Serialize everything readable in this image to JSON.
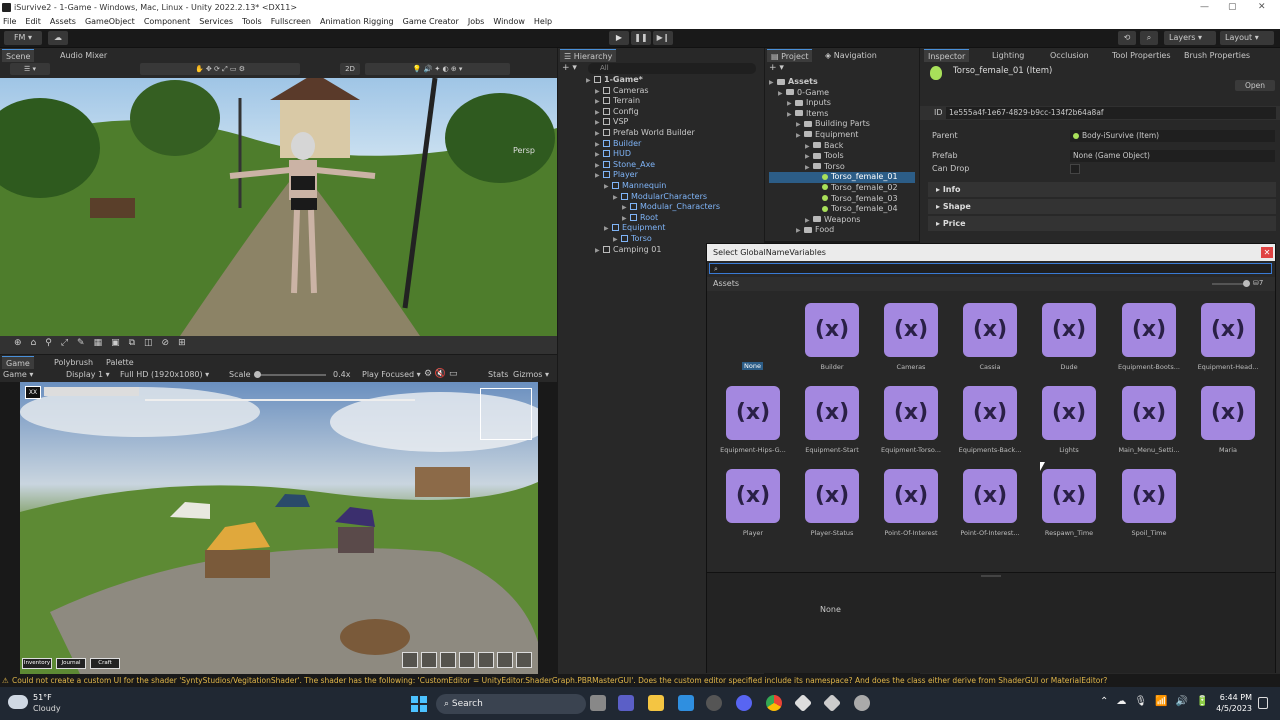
{
  "window": {
    "title": "iSurvive2 - 1-Game - Windows, Mac, Linux - Unity 2022.2.13* <DX11>"
  },
  "menu": [
    "File",
    "Edit",
    "Assets",
    "GameObject",
    "Component",
    "Services",
    "Tools",
    "Fullscreen",
    "Animation Rigging",
    "Game Creator",
    "Jobs",
    "Window",
    "Help"
  ],
  "toolbar": {
    "account": "FM",
    "layers": "Layers",
    "layout": "Layout"
  },
  "scene": {
    "tab_scene": "Scene",
    "tab_audio": "Audio Mixer",
    "mode_2d": "2D",
    "persp": "Persp"
  },
  "game": {
    "tab_game": "Game",
    "tab_polybrush": "Polybrush",
    "tab_palette": "Palette",
    "view": "Game",
    "display": "Display 1",
    "resolution": "Full HD (1920x1080)",
    "scale_label": "Scale",
    "scale_value": "0.4x",
    "play_focused": "Play Focused",
    "stats": "Stats",
    "gizmos": "Gizmos",
    "hud_id": "XX",
    "btn_inventory": "Inventory",
    "btn_journal": "Journal",
    "btn_craft": "Craft"
  },
  "hierarchy": {
    "tab": "Hierarchy",
    "search_placeholder": "All",
    "items": [
      "1-Game*",
      "Cameras",
      "Terrain",
      "Config",
      "VSP",
      "Prefab World Builder",
      "Builder",
      "HUD",
      "Stone_Axe",
      "Player",
      "Mannequin",
      "ModularCharacters",
      "Modular_Characters",
      "Root",
      "Equipment",
      "Torso",
      "Camping 01"
    ]
  },
  "project": {
    "tab_project": "Project",
    "tab_navigation": "Navigation",
    "items": [
      "Assets",
      "0-Game",
      "Inputs",
      "Items",
      "Building Parts",
      "Equipment",
      "Back",
      "Tools",
      "Torso",
      "Torso_female_01",
      "Torso_female_02",
      "Torso_female_03",
      "Torso_female_04",
      "Weapons",
      "Food"
    ]
  },
  "inspector": {
    "tabs": [
      "Inspector",
      "Lighting",
      "Occlusion",
      "Tool Properties",
      "Brush Properties"
    ],
    "object_title": "Torso_female_01 (Item)",
    "open": "Open",
    "id_label": "ID",
    "id_value": "1e555a4f-1e67-4829-b9cc-134f2b64a8af",
    "parent_label": "Parent",
    "parent_value": "Body-iSurvive (Item)",
    "prefab_label": "Prefab",
    "prefab_value": "None (Game Object)",
    "candrop_label": "Can Drop",
    "sections": [
      "Info",
      "Shape",
      "Price"
    ]
  },
  "dialog": {
    "title": "Select GlobalNameVariables",
    "assets_label": "Assets",
    "count": "7",
    "none_label": "None",
    "footer_none": "None",
    "glyph": "(x)",
    "items": [
      "Builder",
      "Cameras",
      "Cassia",
      "Dude",
      "Equipment-Boots...",
      "Equipment-Head...",
      "Equipment-Hips-G...",
      "Equipment-Start",
      "Equipment-Torso...",
      "Equipments-Back...",
      "Lights",
      "Main_Menu_Setti...",
      "Maria",
      "Player",
      "Player-Status",
      "Point-Of-Interest",
      "Point-Of-Interest...",
      "Respawn_Time",
      "Spoil_Time"
    ]
  },
  "status": {
    "message": "Could not create a custom UI for the shader 'SyntyStudios/VegitationShader'. The shader has the following: 'CustomEditor = UnityEditor.ShaderGraph.PBRMasterGUI'. Does the custom editor specified include its namespace? And does the class either derive from ShaderGUI or MaterialEditor?"
  },
  "taskbar": {
    "temp": "51°F",
    "weather": "Cloudy",
    "search": "Search",
    "time": "6:44 PM",
    "date": "4/5/2023"
  },
  "colors": {
    "accent": "#4a90d9",
    "variable_tile": "#a488e0",
    "selection": "#2c5d87"
  }
}
